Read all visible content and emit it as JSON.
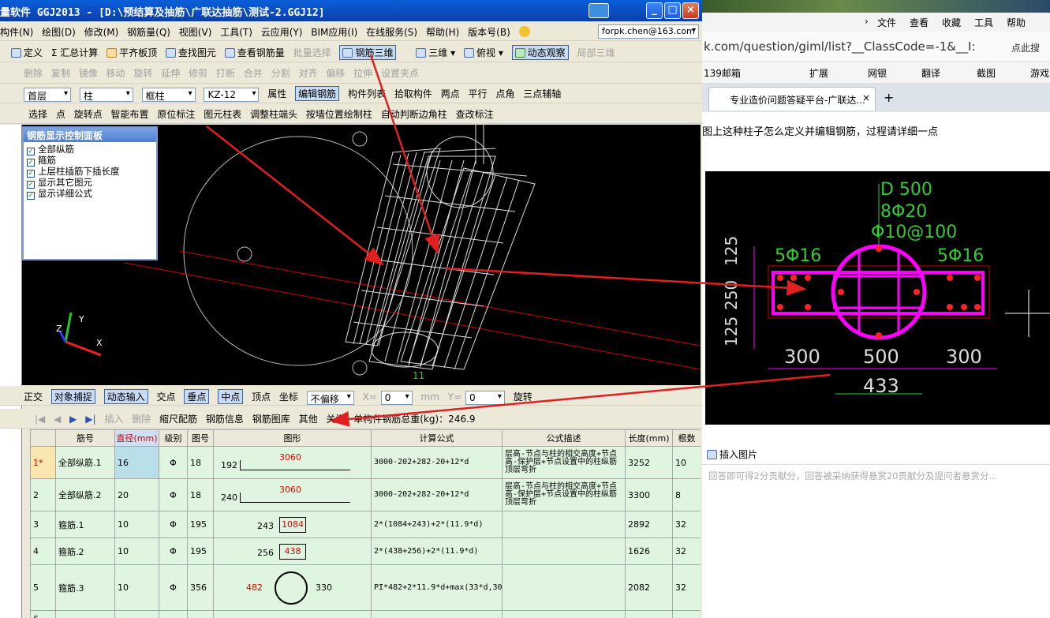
{
  "app": {
    "title": "量软件 GGJ2013 - [D:\\预结算及抽筋\\广联达抽筋\\测试-2.GGJ12]",
    "menus": [
      "构件(N)",
      "绘图(D)",
      "修改(M)",
      "钢筋量(Q)",
      "视图(V)",
      "工具(T)",
      "云应用(Y)",
      "BIM应用(I)",
      "在线服务(S)",
      "帮助(H)",
      "版本号(B)"
    ],
    "account": "forpk.chen@163.com",
    "toolbar1": [
      "定义",
      "Σ 汇总计算",
      "平齐板顶",
      "查找图元",
      "查看钢筋量",
      "批量选择",
      "钢筋三维",
      "三维",
      "俯视",
      "动态观察",
      "局部三维"
    ],
    "toolbar2": [
      "删除",
      "复制",
      "镜像",
      "移动",
      "旋转",
      "延伸",
      "修剪",
      "打断",
      "合并",
      "分割",
      "对齐",
      "偏移",
      "拉伸",
      "设置夹点"
    ],
    "toolbar3": {
      "floor": "首层",
      "type": "柱",
      "subtype": "框柱",
      "code": "KZ-12",
      "buttons": [
        "属性",
        "编辑钢筋",
        "构件列表",
        "拾取构件",
        "两点",
        "平行",
        "点角",
        "三点辅轴"
      ]
    },
    "toolbar4": [
      "选择",
      "点",
      "旋转点",
      "智能布置",
      "原位标注",
      "图元柱表",
      "调整柱端头",
      "按墙位置绘制柱",
      "自动判断边角柱",
      "查改标注"
    ],
    "panel": {
      "title": "钢筋显示控制面板",
      "items": [
        "全部纵筋",
        "箍筋",
        "上层柱插筋下插长度",
        "显示其它图元",
        "显示详细公式"
      ]
    },
    "axis": {
      "x": "X",
      "y": "Y",
      "z": "Z"
    },
    "snapbar": [
      "正交",
      "对象捕捉",
      "动态输入",
      "交点",
      "垂点",
      "中点",
      "顶点",
      "坐标",
      "不偏移",
      "X=",
      "0",
      "mm",
      "Y=",
      "0",
      "旋转"
    ],
    "rebar_toolbar": [
      "插入",
      "删除",
      "缩尺配筋",
      "钢筋信息",
      "钢筋图库",
      "其他",
      "关闭"
    ],
    "total_weight": "单构件钢筋总重(kg)：246.9",
    "table": {
      "headers": [
        "",
        "筋号",
        "直径(mm)",
        "级别",
        "图号",
        "图形",
        "计算公式",
        "公式描述",
        "长度(mm)",
        "根数"
      ],
      "rows": [
        {
          "no": "1*",
          "name": "全部纵筋.1",
          "dia": "16",
          "grade": "Φ",
          "fig": "18",
          "shape_left": "192",
          "shape_top": "3060",
          "shape_right": "",
          "formula": "3000-202+282-20+12*d",
          "desc": "层高-节点与柱的相交高度+节点高-保护层+节点设置中的柱纵筋顶层弯折",
          "len": "3252",
          "count": "10"
        },
        {
          "no": "2",
          "name": "全部纵筋.2",
          "dia": "20",
          "grade": "Φ",
          "fig": "18",
          "shape_left": "240",
          "shape_top": "3060",
          "shape_right": "",
          "formula": "3000-202+282-20+12*d",
          "desc": "层高-节点与柱的相交高度+节点高-保护层+节点设置中的柱纵筋顶层弯折",
          "len": "3300",
          "count": "8"
        },
        {
          "no": "3",
          "name": "箍筋.1",
          "dia": "10",
          "grade": "Φ",
          "fig": "195",
          "shape_left": "243",
          "shape_top": "1084",
          "shape_right": "",
          "formula": "2*(1084+243)+2*(11.9*d)",
          "desc": "",
          "len": "2892",
          "count": "32"
        },
        {
          "no": "4",
          "name": "箍筋.2",
          "dia": "10",
          "grade": "Φ",
          "fig": "195",
          "shape_left": "256",
          "shape_top": "438",
          "shape_right": "",
          "formula": "2*(438+256)+2*(11.9*d)",
          "desc": "",
          "len": "1626",
          "count": "32"
        },
        {
          "no": "5",
          "name": "箍筋.3",
          "dia": "10",
          "grade": "Φ",
          "fig": "356",
          "shape_left": "482",
          "shape_top": "",
          "shape_right": "330",
          "formula": "PI*482+2*11.9*d+max(33*d,300)",
          "desc": "",
          "len": "2082",
          "count": "32"
        },
        {
          "no": "6",
          "name": "",
          "dia": "",
          "grade": "",
          "fig": "",
          "shape_left": "",
          "shape_top": "",
          "shape_right": "",
          "formula": "",
          "desc": "",
          "len": "",
          "count": ""
        }
      ]
    },
    "view_label": "11"
  },
  "browser": {
    "menu": [
      "文件",
      "查看",
      "收藏",
      "工具",
      "帮助"
    ],
    "url": "k.com/question/giml/list?__ClassCode=-1&__I:",
    "url_right": "点此搜",
    "favs": [
      "139邮箱",
      "扩展",
      "网银",
      "翻译",
      "截图",
      "游戏"
    ],
    "tab_title": "专业造价问题答疑平台-广联达...",
    "question": "图上这种柱子怎么定义并编辑钢筋，过程请详细一点",
    "cad": {
      "d": "D 500",
      "long": "8Φ20",
      "stirrup": "Φ10@100",
      "left_bar": "5Φ16",
      "right_bar": "5Φ16",
      "v1": "125",
      "v2": "250",
      "v3": "125",
      "h1": "300",
      "h2": "500",
      "h3": "300",
      "h4": "433"
    },
    "insert_image": "插入图片",
    "answer_hint": "回答即可得2分贡献分，回答被采纳获得悬赏20贡献分及提问者悬赏分..."
  }
}
